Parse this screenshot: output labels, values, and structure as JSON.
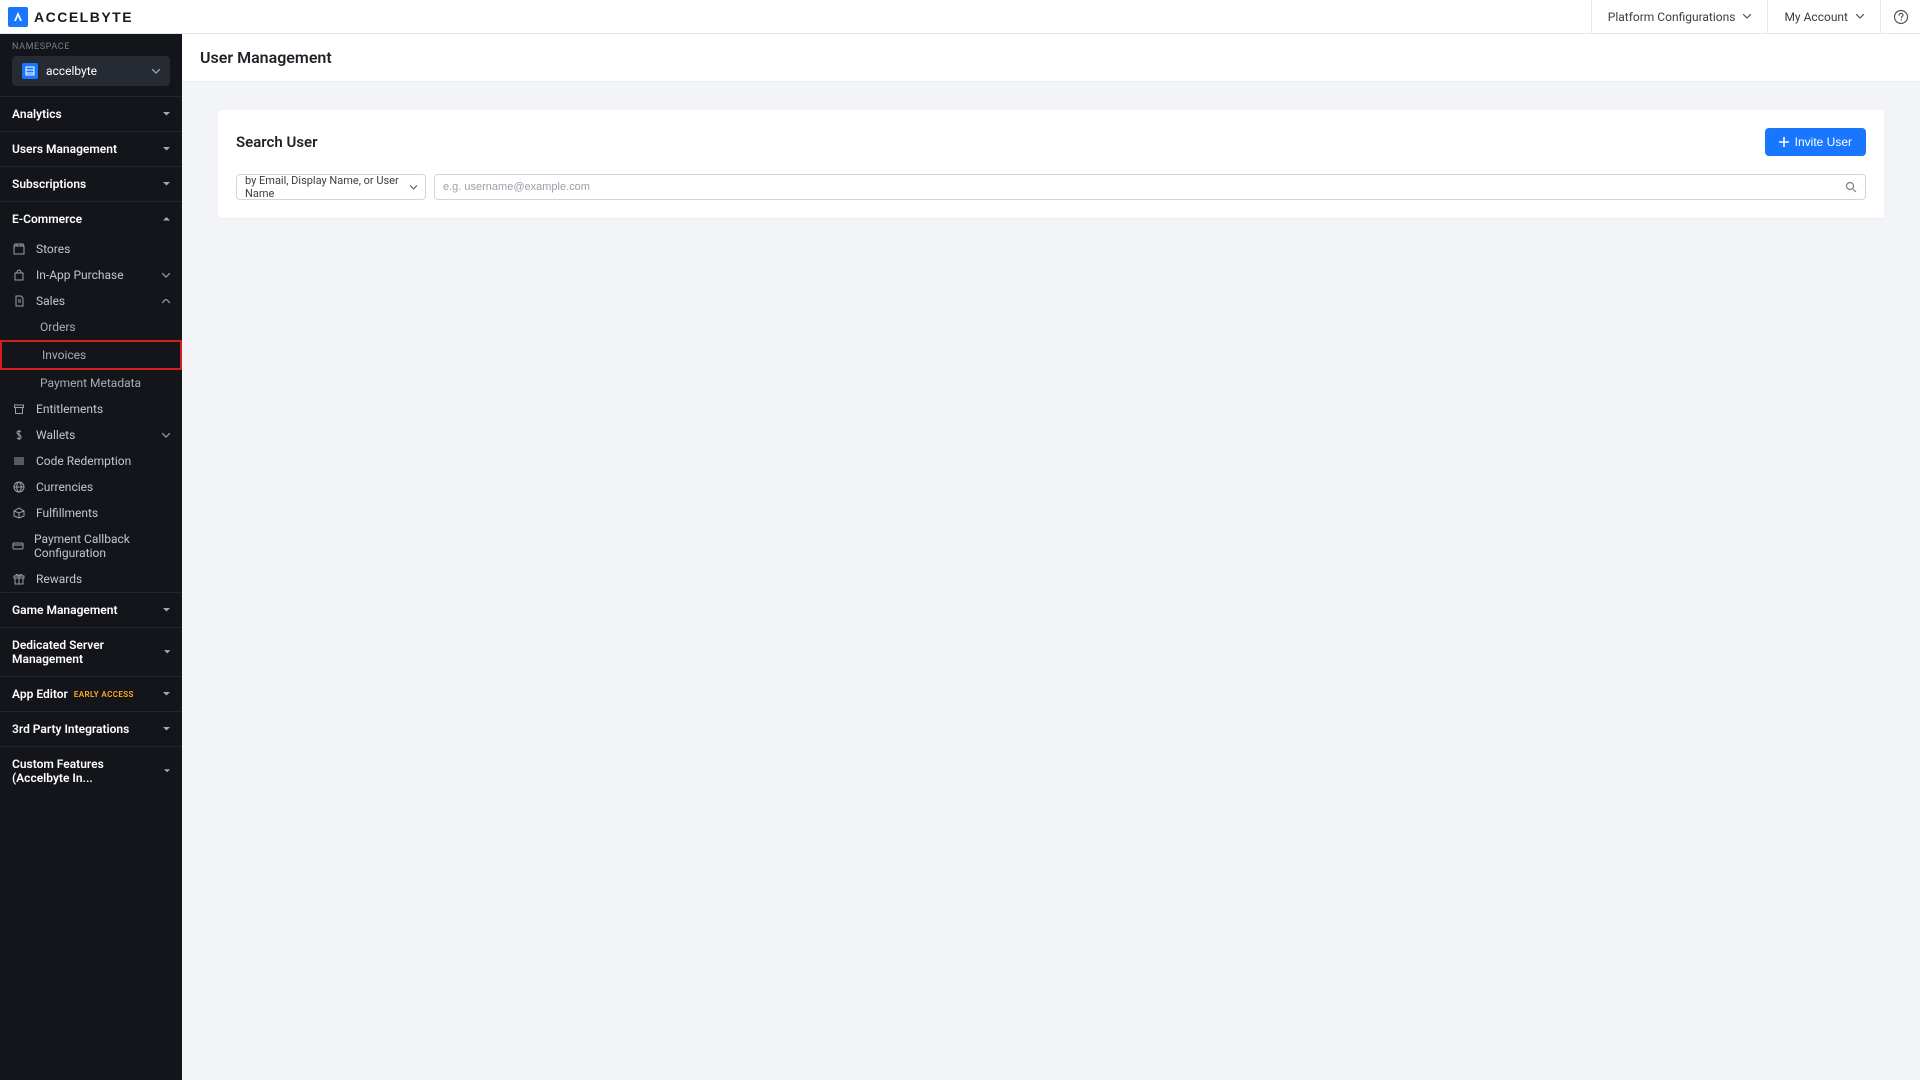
{
  "header": {
    "brand": "ACCELBYTE",
    "platform_config": "Platform Configurations",
    "my_account": "My Account"
  },
  "sidebar": {
    "namespace_label": "NAMESPACE",
    "namespace_value": "accelbyte",
    "sections": {
      "analytics": "Analytics",
      "users_management": "Users Management",
      "subscriptions": "Subscriptions",
      "ecommerce": "E-Commerce",
      "game_management": "Game Management",
      "dedicated_server": "Dedicated Server Management",
      "app_editor": "App Editor",
      "app_editor_badge": "EARLY ACCESS",
      "third_party": "3rd Party Integrations",
      "custom_features": "Custom Features (Accelbyte In..."
    },
    "ecommerce_items": {
      "stores": "Stores",
      "in_app_purchase": "In-App Purchase",
      "sales": "Sales",
      "orders": "Orders",
      "invoices": "Invoices",
      "payment_metadata": "Payment Metadata",
      "entitlements": "Entitlements",
      "wallets": "Wallets",
      "code_redemption": "Code Redemption",
      "currencies": "Currencies",
      "fulfillments": "Fulfillments",
      "payment_callback": "Payment Callback Configuration",
      "rewards": "Rewards"
    }
  },
  "page": {
    "title": "User Management",
    "panel_title": "Search User",
    "invite_btn": "Invite User",
    "search_criteria": "by Email, Display Name, or User Name",
    "search_placeholder": "e.g. username@example.com"
  }
}
